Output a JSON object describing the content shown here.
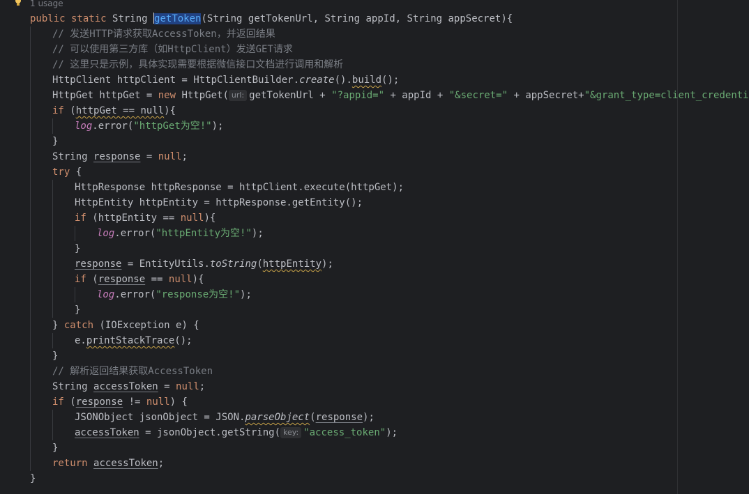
{
  "usages": "1 usage",
  "hints": {
    "url": "url:",
    "key": "key:"
  },
  "code": {
    "method_name": "getToken",
    "l1_sig": "(String getTokenUrl, String appId, String appSecret){",
    "c1": "// 发送HTTP请求获取AccessToken，并返回结果",
    "c2": "// 可以使用第三方库（如HttpClient）发送GET请求",
    "c3": "// 这里只是示例，具体实现需要根据微信接口文档进行调用和解析",
    "c4": "// 解析返回结果获取AccessToken",
    "s_appid": "\"?appid=\"",
    "s_secret": "\"&secret=\"",
    "s_grant": "\"&grant_type=client_credential\"",
    "s_httpget_null": "\"httpGet为空!\"",
    "s_entity_null": "\"httpEntity为空!\"",
    "s_response_null": "\"response为空!\"",
    "s_access_token": "\"access_token\""
  }
}
